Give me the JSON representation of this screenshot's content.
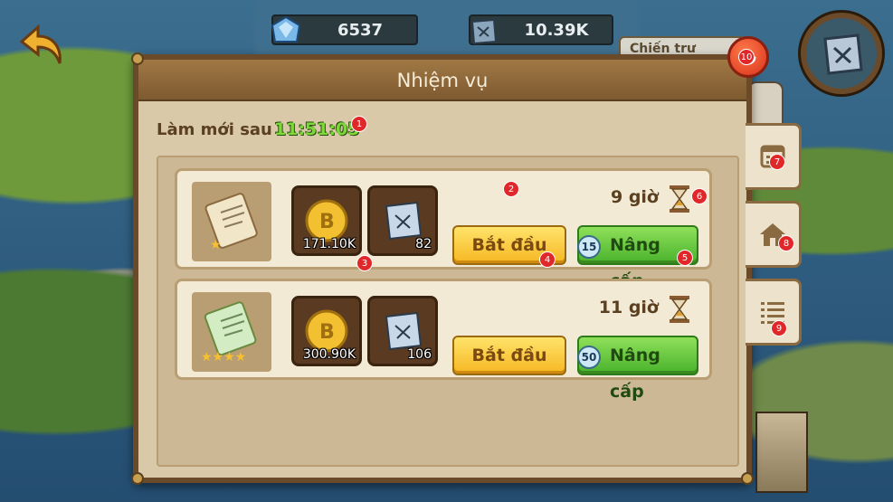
{
  "topbar": {
    "gems_value": "6537",
    "scroll_value": "10.39K",
    "battle_label": "Chiến trư"
  },
  "dialog": {
    "title": "Nhiệm vụ",
    "refresh_label": "Làm mới sau",
    "refresh_time": "11:51:05"
  },
  "missions": [
    {
      "gold": "171.10K",
      "scrolls": "82",
      "duration": "9 giờ",
      "start_label": "Bắt đầu",
      "upgrade_label": "Nâng cấp",
      "upgrade_cost": "15",
      "stars": 1
    },
    {
      "gold": "300.90K",
      "scrolls": "106",
      "duration": "11 giờ",
      "start_label": "Bắt đầu",
      "upgrade_label": "Nâng cấp",
      "upgrade_cost": "50",
      "stars": 4
    }
  ],
  "markers": [
    "1",
    "2",
    "3",
    "4",
    "5",
    "6",
    "7",
    "8",
    "9",
    "10"
  ],
  "colors": {
    "accent_green": "#7ed83a",
    "start_button": "#f6b723",
    "upgrade_button": "#49b22c",
    "close_button": "#d8321a"
  },
  "icons": {
    "back": "back-arrow-icon",
    "gems": "gem-icon",
    "scroll": "scroll-bag-icon",
    "close": "close-icon",
    "tab1": "calendar-icon",
    "tab2": "home-icon",
    "tab3": "list-icon"
  }
}
